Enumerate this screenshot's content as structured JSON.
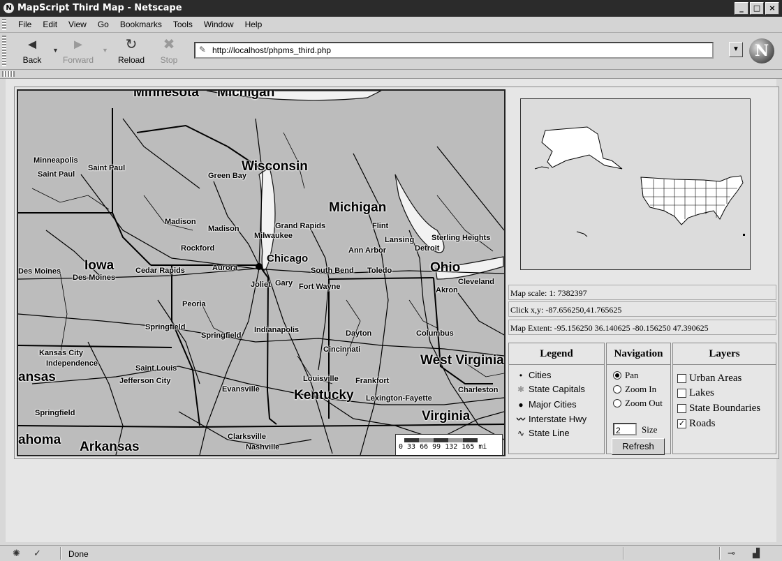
{
  "window": {
    "title": "MapScript Third Map - Netscape",
    "logo_icon": "netscape-icon",
    "controls": [
      "_",
      "̵□",
      "X"
    ]
  },
  "menu": [
    "File",
    "Edit",
    "View",
    "Go",
    "Bookmarks",
    "Tools",
    "Window",
    "Help"
  ],
  "toolbar": {
    "back": "Back",
    "forward": "Forward",
    "reload": "Reload",
    "stop": "Stop",
    "url": "http://localhost/phpms_third.php"
  },
  "map": {
    "states": [
      "Minnesota",
      "Michigan",
      "Wisconsin",
      "Michigan",
      "Iowa",
      "Ohio",
      "West Virginia",
      "Kentucky",
      "Virginia",
      "Arkansas",
      "ansas",
      "ahoma"
    ],
    "cities": [
      "Minneapolis",
      "Saint Paul",
      "Saint Paul",
      "Green Bay",
      "Madison",
      "Madison",
      "Grand Rapids",
      "Milwaukee",
      "Flint",
      "Lansing",
      "Sterling Heights",
      "Detroit",
      "Ann Arbor",
      "Rockford",
      "Des Moines",
      "Des Moines",
      "Cedar Rapids",
      "Aurora",
      "Chicago",
      "South Bend",
      "Toledo",
      "Joliet",
      "Gary",
      "Fort Wayne",
      "Cleveland",
      "Akron",
      "Peoria",
      "Springfield",
      "Springfield",
      "Indianapolis",
      "Dayton",
      "Columbus",
      "Kansas City",
      "Independence",
      "Saint Louis",
      "Jefferson City",
      "Cincinnati",
      "Evansville",
      "Louisville",
      "Frankfort",
      "Lexington-Fayette",
      "Charleston",
      "Springfield",
      "Clarksville",
      "Nashville"
    ],
    "scale_ticks": "0  33  66  99 132 165 mi"
  },
  "info": {
    "scale": "Map scale:  1: 7382397",
    "click": "Click x,y:     -87.656250,41.765625",
    "extent": "Map Extent:  -95.156250 36.140625 -80.156250 47.390625"
  },
  "legend": {
    "title": "Legend",
    "items": [
      "Cities",
      "State Capitals",
      "Major Cities",
      "Interstate Hwy",
      "State Line"
    ]
  },
  "navigation": {
    "title": "Navigation",
    "options": [
      "Pan",
      "Zoom In",
      "Zoom Out"
    ],
    "selected": 0,
    "size_value": "2",
    "size_label": "Size",
    "refresh": "Refresh"
  },
  "layers": {
    "title": "Layers",
    "items": [
      {
        "label": "Urban Areas",
        "checked": false
      },
      {
        "label": "Lakes",
        "checked": false
      },
      {
        "label": "State Boundaries",
        "checked": false
      },
      {
        "label": "Roads",
        "checked": true
      }
    ]
  },
  "status": {
    "text": "Done"
  }
}
